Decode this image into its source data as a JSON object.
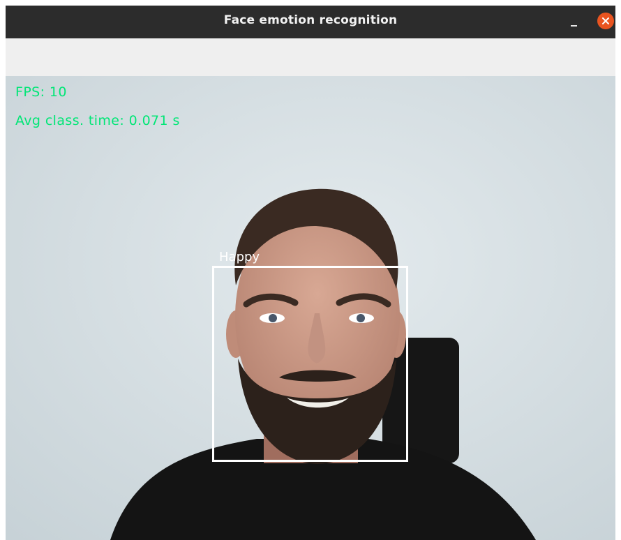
{
  "window": {
    "title": "Face emotion recognition",
    "controls": {
      "minimize_icon": "minimize-icon",
      "close_icon": "close-icon",
      "close_color": "#e95420"
    }
  },
  "video": {
    "fps_text": "FPS: 10",
    "avg_class_time_text": "Avg class. time: 0.071 s",
    "overlay_text_color": "#00e676",
    "detection": {
      "label": "Happy",
      "box_color": "#ffffff"
    }
  }
}
